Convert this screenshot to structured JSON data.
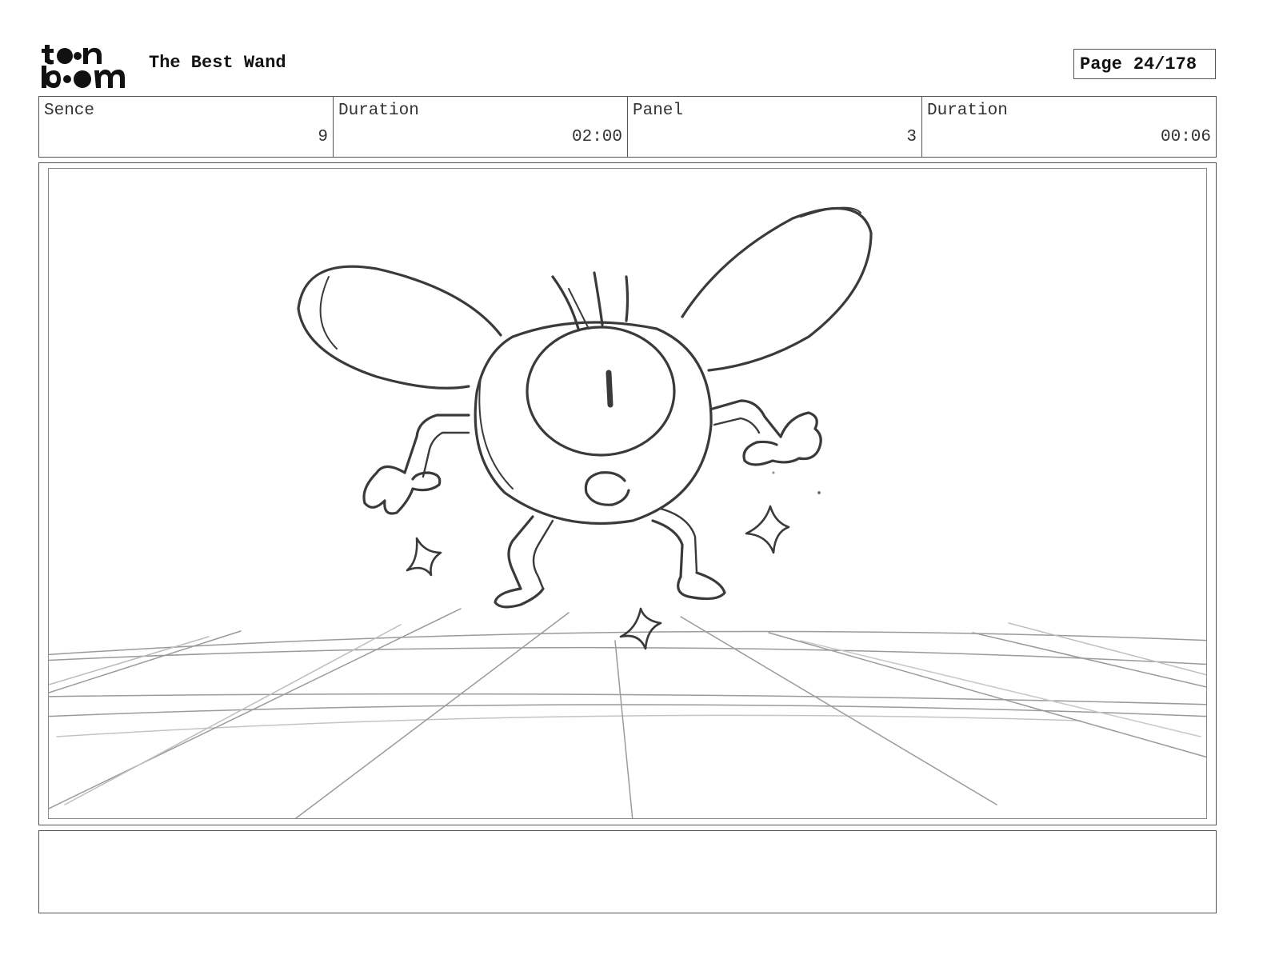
{
  "header": {
    "logo_text_top": "toon",
    "logo_text_bottom": "boom",
    "project_title": "The Best Wand",
    "page_label": "Page",
    "page_number": "24/178"
  },
  "info": {
    "scene_label": "Sence",
    "scene_value": "9",
    "scene_duration_label": "Duration",
    "scene_duration_value": "02:00",
    "panel_label": "Panel",
    "panel_value": "3",
    "panel_duration_label": "Duration",
    "panel_duration_value": "00:06"
  },
  "notes": {
    "text": ""
  }
}
